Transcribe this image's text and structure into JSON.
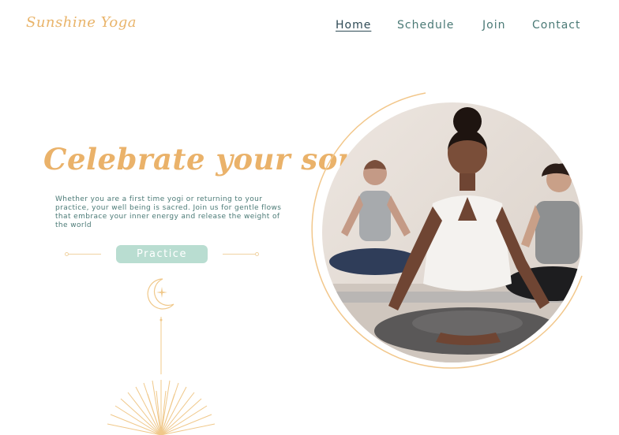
{
  "brand": {
    "logo_text": "Sunshine Yoga"
  },
  "nav": {
    "items": [
      {
        "label": "Home",
        "active": true
      },
      {
        "label": "Schedule",
        "active": false
      },
      {
        "label": "Join",
        "active": false
      },
      {
        "label": "Contact",
        "active": false
      }
    ]
  },
  "hero": {
    "headline": "Celebrate your soul",
    "description": "Whether you are a first time yogi or returning to your practice, your well being is sacred. Join us for gentle flows that embrace your inner energy and release the weight of the world",
    "cta_label": "Practice"
  },
  "colors": {
    "accent_gold": "#eab26a",
    "text_teal": "#4b7a76",
    "button_mint": "#b9ddd1"
  },
  "icons": [
    "crescent-moon-icon",
    "star-icon",
    "sunburst-icon"
  ]
}
